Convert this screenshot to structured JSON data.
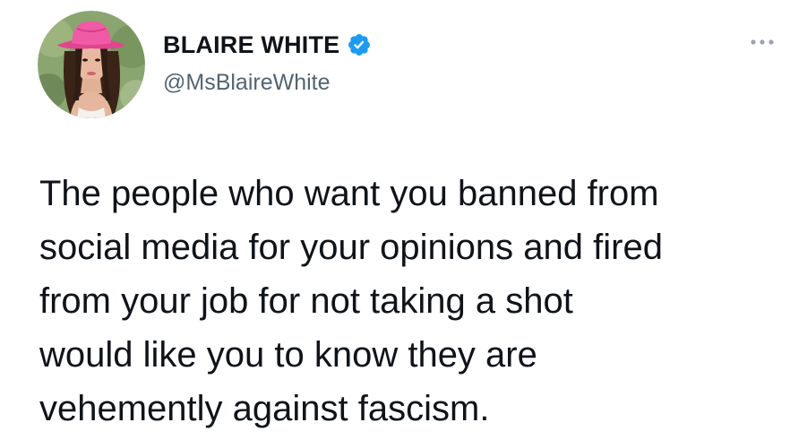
{
  "tweet": {
    "author": {
      "display_name": "BLAIRE WHITE",
      "handle": "@MsBlaireWhite",
      "verified": true,
      "avatar_icon": "profile-photo"
    },
    "more_icon": "ellipsis-icon",
    "text_lines": [
      "The people who want you banned from",
      "social media for your opinions and fired",
      "from your job for not taking a shot",
      "would like you to know they are",
      "vehemently against fascism."
    ]
  },
  "colors": {
    "text": "#0f1419",
    "handle": "#536471",
    "verified": "#1d9bf0",
    "more_icon": "#9aa4ae",
    "hat": "#f05aa6"
  }
}
